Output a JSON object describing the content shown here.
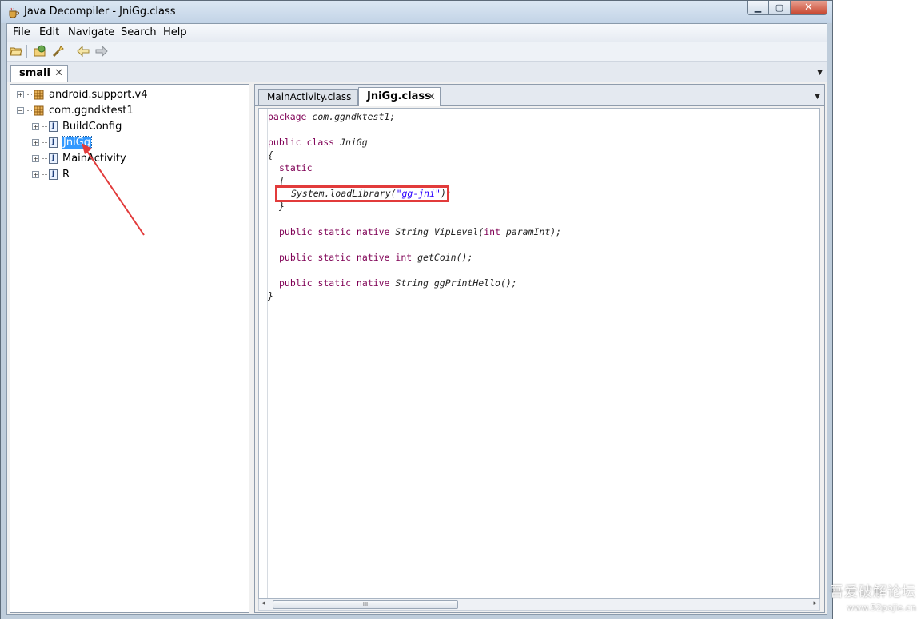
{
  "window": {
    "title": "Java Decompiler - JniGg.class"
  },
  "menu": {
    "items": [
      {
        "label": "File"
      },
      {
        "label": "Edit"
      },
      {
        "label": "Navigate"
      },
      {
        "label": "Search"
      },
      {
        "label": "Help"
      }
    ]
  },
  "outer_tab": {
    "label": "smali",
    "close": "✕"
  },
  "tree": {
    "items": [
      {
        "label": "android.support.v4",
        "type": "package",
        "expander": "+"
      },
      {
        "label": "com.ggndktest1",
        "type": "package",
        "expander": "−"
      },
      {
        "label": "BuildConfig",
        "type": "class",
        "expander": "+"
      },
      {
        "label": "JniGg",
        "type": "class",
        "expander": "+",
        "selected": true
      },
      {
        "label": "MainActivity",
        "type": "class",
        "expander": "+"
      },
      {
        "label": "R",
        "type": "class",
        "expander": "+"
      }
    ]
  },
  "editor": {
    "tabs": [
      {
        "label": "MainActivity.class",
        "active": false
      },
      {
        "label": "JniGg.class",
        "active": true,
        "close": "✕"
      }
    ],
    "code": {
      "l1_kw": "package",
      "l1_rest": " com.ggndktest1;",
      "l2_kw1": "public",
      "l2_kw2": "class",
      "l2_rest": " JniGg",
      "l3": "{",
      "l4_kw": "static",
      "l5": "{",
      "l6_pre": "System.loadLibrary(",
      "l6_str": "\"gg-jni\"",
      "l6_post": ");",
      "l7": "}",
      "l8_kw": "public static native",
      "l8_rest": " String VipLevel(",
      "l8_kw2": "int",
      "l8_rest2": " paramInt);",
      "l9_kw": "public static native",
      "l9_kw2": "int",
      "l9_rest": " getCoin();",
      "l10_kw": "public static native",
      "l10_rest": " String ggPrintHello();",
      "l11": "}"
    }
  },
  "scrollbar": {
    "grip": "III",
    "left": "◂",
    "right": "▸"
  },
  "watermark": {
    "line1": "吾爱破解论坛",
    "line2": "www.52pojie.cn"
  },
  "colors": {
    "keyword": "#7f0055",
    "string": "#2a00ff",
    "highlight_box": "#e23b3b",
    "selection": "#3399ff"
  }
}
